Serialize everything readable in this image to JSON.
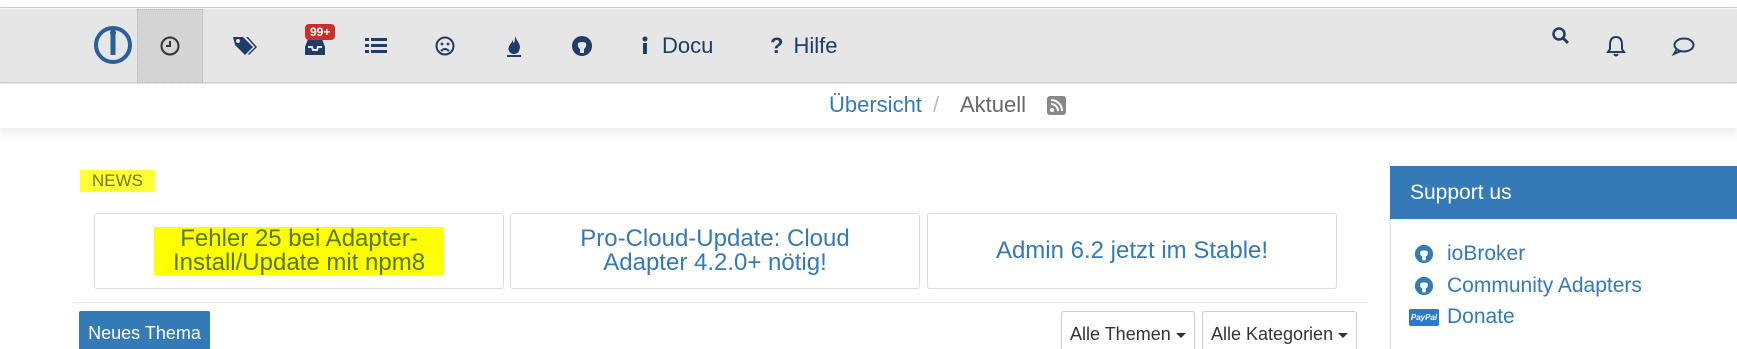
{
  "nav": {
    "badge": "99+",
    "docu_label": "Docu",
    "hilfe_label": "Hilfe"
  },
  "breadcrumb": {
    "overview": "Übersicht",
    "separator": "/",
    "current": "Aktuell"
  },
  "news": {
    "label": "NEWS",
    "cards": [
      "Fehler 25 bei Adapter-Install/Update mit npm8",
      "Pro-Cloud-Update: Cloud Adapter 4.2.0+ nötig!",
      "Admin 6.2 jetzt im Stable!"
    ]
  },
  "actions": {
    "new_topic": "Neues Thema",
    "all_topics": "Alle Themen",
    "all_categories": "Alle Kategorien"
  },
  "support": {
    "title": "Support us",
    "links": [
      {
        "label": "ioBroker",
        "icon": "github-icon"
      },
      {
        "label": "Community Adapters",
        "icon": "github-icon"
      },
      {
        "label": "Donate",
        "icon": "paypal-icon"
      }
    ],
    "paypal_text": "PayPal"
  },
  "colors": {
    "accent": "#337ab7",
    "highlight": "#ffff00",
    "badge": "#c9302c",
    "navbar": "#e6e6e6"
  }
}
